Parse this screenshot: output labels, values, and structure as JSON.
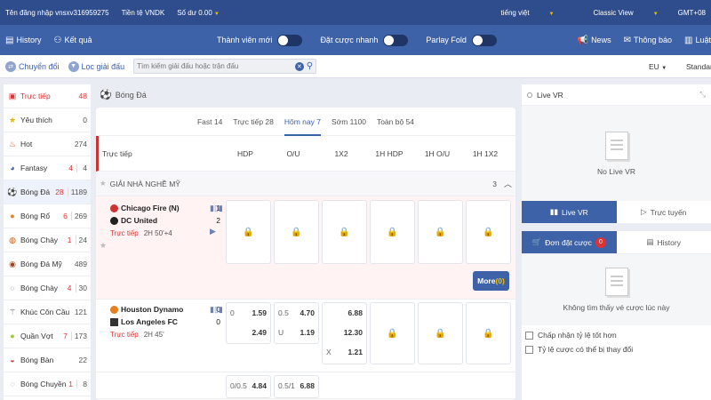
{
  "topbar": {
    "login_label": "Tên đăng nhập",
    "username": "vnsxv316959275",
    "currency_label": "Tiền tệ",
    "currency": "VNDK",
    "balance_label": "Số dư",
    "balance": "0.00",
    "language": "tiếng việt",
    "view_mode": "Classic View",
    "timezone": "GMT+08"
  },
  "navbar": {
    "history": "History",
    "results": "Kết quả",
    "new_member": "Thành viên mới",
    "quick_bet": "Đặt cược nhanh",
    "parlay_fold": "Parlay Fold",
    "news": "News",
    "notice": "Thông báo",
    "rules": "Luật"
  },
  "filterbar": {
    "switch": "Chuyển đổi",
    "filter_league": "Lọc giải đấu",
    "search_placeholder": "Tìm kiếm giải đấu hoặc trận đấu",
    "odds_type": "EU",
    "view": "Standar"
  },
  "sidebar": {
    "items": [
      {
        "label": "Trực tiếp",
        "icon": "live-icon",
        "live": "",
        "count": "48"
      },
      {
        "label": "Yêu thích",
        "icon": "star-icon",
        "live": "",
        "count": "0"
      },
      {
        "label": "Hot",
        "icon": "fire-icon",
        "live": "",
        "count": "274"
      },
      {
        "label": "Fantasy",
        "icon": "fantasy-icon",
        "live": "4",
        "count": "4"
      },
      {
        "label": "Bóng Đá",
        "icon": "soccer-ball-icon",
        "live": "28",
        "count": "1189"
      },
      {
        "label": "Bóng Rổ",
        "icon": "basketball-icon",
        "live": "6",
        "count": "269"
      },
      {
        "label": "Bóng Chày",
        "icon": "baseball-icon",
        "live": "1",
        "count": "24"
      },
      {
        "label": "Bóng Đá Mỹ",
        "icon": "american-football-icon",
        "live": "",
        "count": "489"
      },
      {
        "label": "Bóng Chày",
        "icon": "softball-icon",
        "live": "4",
        "count": "30"
      },
      {
        "label": "Khúc Côn Cầu",
        "icon": "hockey-icon",
        "live": "",
        "count": "121"
      },
      {
        "label": "Quần Vợt",
        "icon": "tennis-icon",
        "live": "7",
        "count": "173"
      },
      {
        "label": "Bóng Bàn",
        "icon": "table-tennis-icon",
        "live": "",
        "count": "22"
      },
      {
        "label": "Bóng Chuyền",
        "icon": "volleyball-icon",
        "live": "1",
        "count": "8"
      }
    ]
  },
  "main": {
    "sport_title": "Bóng Đá",
    "tabs": [
      "Fast 14",
      "Trực tiếp 28",
      "Hôm nay 7",
      "Sớm 1100",
      "Toàn bộ 54"
    ],
    "columns": [
      "Trực tiếp",
      "HDP",
      "O/U",
      "1X2",
      "1H HDP",
      "1H O/U",
      "1H 1X2"
    ],
    "league": {
      "name": "GIẢI NHÀ NGHỀ MỸ",
      "count": "3"
    },
    "matches": [
      {
        "home": "Chicago Fire (N)",
        "away": "DC United",
        "home_score": "1",
        "away_score": "2",
        "status": "Trực tiếp",
        "time": "2H 50'+4",
        "more_label": "More",
        "more_count": "(0)"
      },
      {
        "home": "Houston Dynamo",
        "away": "Los Angeles FC",
        "home_score": "0",
        "away_score": "0",
        "status": "Trực tiếp",
        "time": "2H 45'",
        "hdp": [
          {
            "line": "0",
            "odds": "1.59"
          },
          {
            "line": "",
            "odds": "2.49"
          }
        ],
        "ou": [
          {
            "line": "0.5",
            "odds": "4.70"
          },
          {
            "line": "U",
            "odds": "1.19"
          }
        ],
        "x12": [
          {
            "line": "",
            "odds": "6.88"
          },
          {
            "line": "",
            "odds": "12.30"
          },
          {
            "line": "X",
            "odds": "1.21"
          }
        ]
      },
      {
        "hdp_line": "0/0.5",
        "hdp_odds": "4.84",
        "ou_line": "0.5/1",
        "ou_odds": "6.88"
      }
    ]
  },
  "right": {
    "live_vr": "Live VR",
    "no_live_vr": "No Live VR",
    "tab_live_vr": "Live VR",
    "tab_live_stream": "Trực tuyến",
    "tab_bet_slip": "Đơn đặt cược",
    "bet_count": "0",
    "tab_history": "History",
    "no_bets": "Không tìm thấy vé cược lúc này",
    "accept_better": "Chấp nhận tỷ lệ tốt hơn",
    "odds_may_change": "Tỷ lệ cược có thể bị thay đổi"
  }
}
